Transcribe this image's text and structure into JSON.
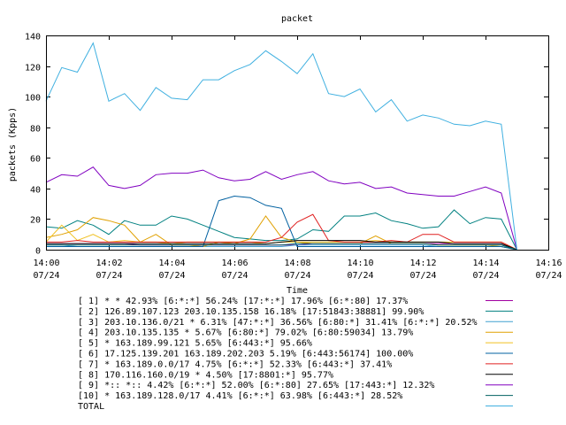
{
  "chart_data": {
    "type": "line",
    "title": "packet",
    "xlabel": "Time",
    "ylabel": "packets (Kpps)",
    "ylim": [
      0,
      140
    ],
    "xlim": [
      "14:00",
      "14:16"
    ],
    "y_ticks": [
      "0",
      "20",
      "40",
      "60",
      "80",
      "100",
      "120",
      "140"
    ],
    "x_ticks": [
      {
        "time": "14:00",
        "date": "07/24"
      },
      {
        "time": "14:02",
        "date": "07/24"
      },
      {
        "time": "14:04",
        "date": "07/24"
      },
      {
        "time": "14:06",
        "date": "07/24"
      },
      {
        "time": "14:08",
        "date": "07/24"
      },
      {
        "time": "14:10",
        "date": "07/24"
      },
      {
        "time": "14:12",
        "date": "07/24"
      },
      {
        "time": "14:14",
        "date": "07/24"
      },
      {
        "time": "14:16",
        "date": "07/24"
      }
    ],
    "grid": false,
    "legend_position": "bottom",
    "x_minutes": [
      0,
      0.5,
      1,
      1.5,
      2,
      2.5,
      3,
      3.5,
      4,
      4.5,
      5,
      5.5,
      6,
      6.5,
      7,
      7.5,
      8,
      8.5,
      9,
      9.5,
      10,
      10.5,
      11,
      11.5,
      12,
      12.5,
      13,
      13.5,
      14,
      14.5,
      15
    ],
    "series": [
      {
        "name": "[ 1] * * 42.93%  [6:*:*] 56.24% [17:*:*] 17.96% [6:*:80] 17.37%",
        "color": "#a000a0",
        "values": [
          4,
          4,
          4,
          4,
          4,
          4,
          3,
          3,
          3,
          3,
          3,
          3,
          3,
          3,
          3,
          3,
          3,
          4,
          4,
          4,
          4,
          4,
          4,
          4,
          4,
          4,
          4,
          4,
          4,
          4,
          0
        ]
      },
      {
        "name": "[ 2] 126.89.107.123 203.10.135.158 16.18%  [17:51843:38881] 99.90%",
        "color": "#008080",
        "values": [
          15,
          14,
          19,
          16,
          10,
          19,
          16,
          16,
          22,
          20,
          16,
          12,
          8,
          7,
          6,
          6,
          7,
          13,
          12,
          22,
          22,
          24,
          19,
          17,
          14,
          15,
          26,
          17,
          21,
          20,
          0
        ]
      },
      {
        "name": "[ 3] 203.10.136.0/21 * 6.31%  [47:*:*] 36.56% [6:80:*] 31.41% [6:*:*] 20.52%",
        "color": "#40a0d0",
        "values": [
          3,
          3,
          2,
          2,
          2,
          2,
          2,
          2,
          2,
          2,
          2,
          2,
          2,
          2,
          2,
          2,
          3,
          3,
          3,
          3,
          3,
          3,
          3,
          3,
          3,
          2,
          2,
          2,
          2,
          2,
          0
        ]
      },
      {
        "name": "[ 4] 203.10.135.135 * 5.67%  [6:80:*] 79.02% [6:80:59034] 13.79%",
        "color": "#e0a000",
        "values": [
          8,
          10,
          13,
          21,
          19,
          16,
          5,
          10,
          3,
          3,
          2,
          5,
          4,
          7,
          22,
          8,
          5,
          4,
          4,
          4,
          4,
          9,
          4,
          4,
          4,
          3,
          3,
          3,
          3,
          2,
          0
        ]
      },
      {
        "name": "[ 5] * 163.189.99.121 5.65%  [6:443:*] 95.66%",
        "color": "#f0c020",
        "values": [
          5,
          16,
          6,
          10,
          5,
          6,
          5,
          5,
          4,
          5,
          5,
          5,
          5,
          5,
          4,
          5,
          5,
          5,
          5,
          5,
          5,
          6,
          5,
          5,
          5,
          5,
          5,
          5,
          5,
          5,
          0
        ]
      },
      {
        "name": "[ 6] 17.125.139.201 163.189.202.203 5.19%  [6:443:56174] 100.00%",
        "color": "#0060a0",
        "values": [
          2,
          2,
          2,
          2,
          2,
          2,
          2,
          2,
          2,
          2,
          2,
          32,
          35,
          34,
          29,
          27,
          2,
          2,
          2,
          2,
          2,
          2,
          2,
          2,
          2,
          2,
          2,
          2,
          2,
          2,
          0
        ]
      },
      {
        "name": "[ 7] * 163.189.0.0/17 4.75%  [6:*:*] 52.33% [6:443:*] 37.41%",
        "color": "#e02020",
        "values": [
          5,
          5,
          6,
          5,
          5,
          5,
          5,
          5,
          5,
          5,
          5,
          5,
          5,
          5,
          5,
          8,
          18,
          23,
          6,
          5,
          5,
          5,
          6,
          5,
          10,
          10,
          5,
          5,
          5,
          5,
          0
        ]
      },
      {
        "name": "[ 8] 170.116.160.0/19 * 4.50%  [17:8801:*] 95.77%",
        "color": "#000000",
        "values": [
          4,
          4,
          4,
          4,
          4,
          4,
          4,
          4,
          4,
          4,
          4,
          4,
          4,
          4,
          4,
          5,
          6,
          6,
          6,
          6,
          6,
          5,
          5,
          5,
          5,
          5,
          4,
          4,
          4,
          4,
          0
        ]
      },
      {
        "name": "[ 9] *:: *:: 4.42%  [6:*:*] 52.00% [6:*:80] 27.65% [17:443:*] 12.32%",
        "color": "#8000c0",
        "values": [
          44,
          49,
          48,
          54,
          42,
          40,
          42,
          49,
          50,
          50,
          52,
          47,
          45,
          46,
          51,
          46,
          49,
          51,
          45,
          43,
          44,
          40,
          41,
          37,
          36,
          35,
          35,
          38,
          41,
          37,
          0
        ]
      },
      {
        "name": "[10] * 163.189.128.0/17 4.41%  [6:*:*] 63.98% [6:443:*] 28.52%",
        "color": "#006060",
        "values": [
          3,
          3,
          3,
          3,
          3,
          3,
          3,
          3,
          3,
          3,
          3,
          3,
          3,
          3,
          3,
          3,
          4,
          4,
          4,
          4,
          4,
          4,
          4,
          4,
          4,
          3,
          3,
          3,
          3,
          3,
          0
        ]
      },
      {
        "name": "TOTAL",
        "color": "#40b0e0",
        "values": [
          97,
          119,
          116,
          135,
          97,
          102,
          91,
          106,
          99,
          98,
          111,
          111,
          117,
          121,
          130,
          123,
          115,
          128,
          102,
          100,
          105,
          90,
          98,
          84,
          88,
          86,
          82,
          81,
          84,
          82,
          0
        ]
      }
    ]
  }
}
